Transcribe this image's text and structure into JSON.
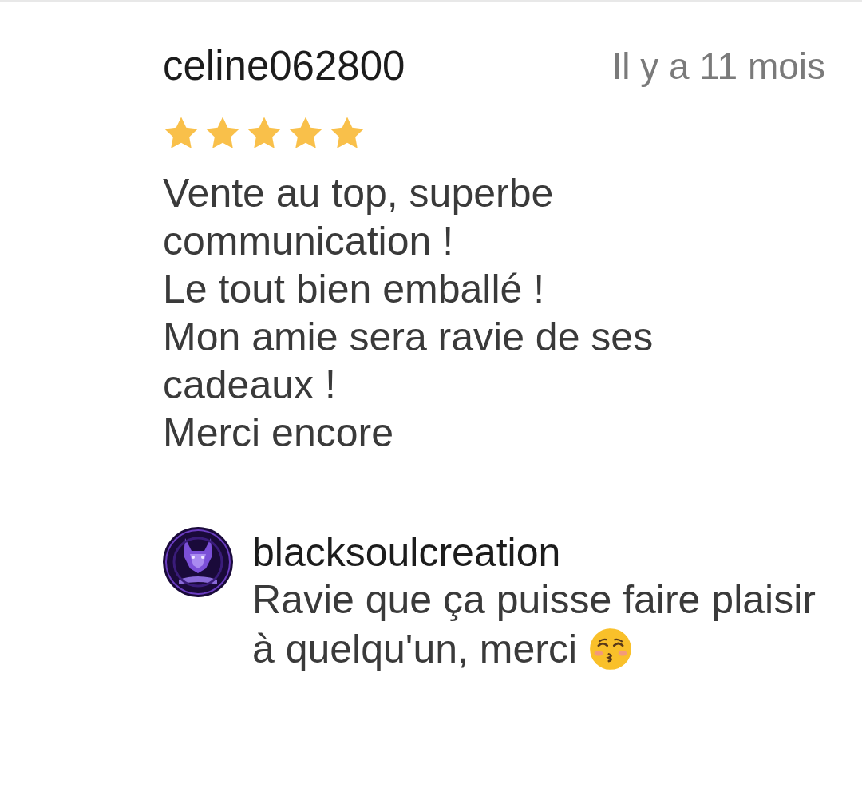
{
  "review": {
    "username": "celine062800",
    "time": "Il y a 11 mois",
    "stars": 5,
    "text": "Vente au top, superbe communication !\nLe tout bien emballé !\nMon amie sera ravie de ses cadeaux !\nMerci encore"
  },
  "reply": {
    "username": "blacksoulcreation",
    "lines": [
      "Ravie que ça puisse faire plaisir",
      "à quelqu'un, merci"
    ]
  }
}
